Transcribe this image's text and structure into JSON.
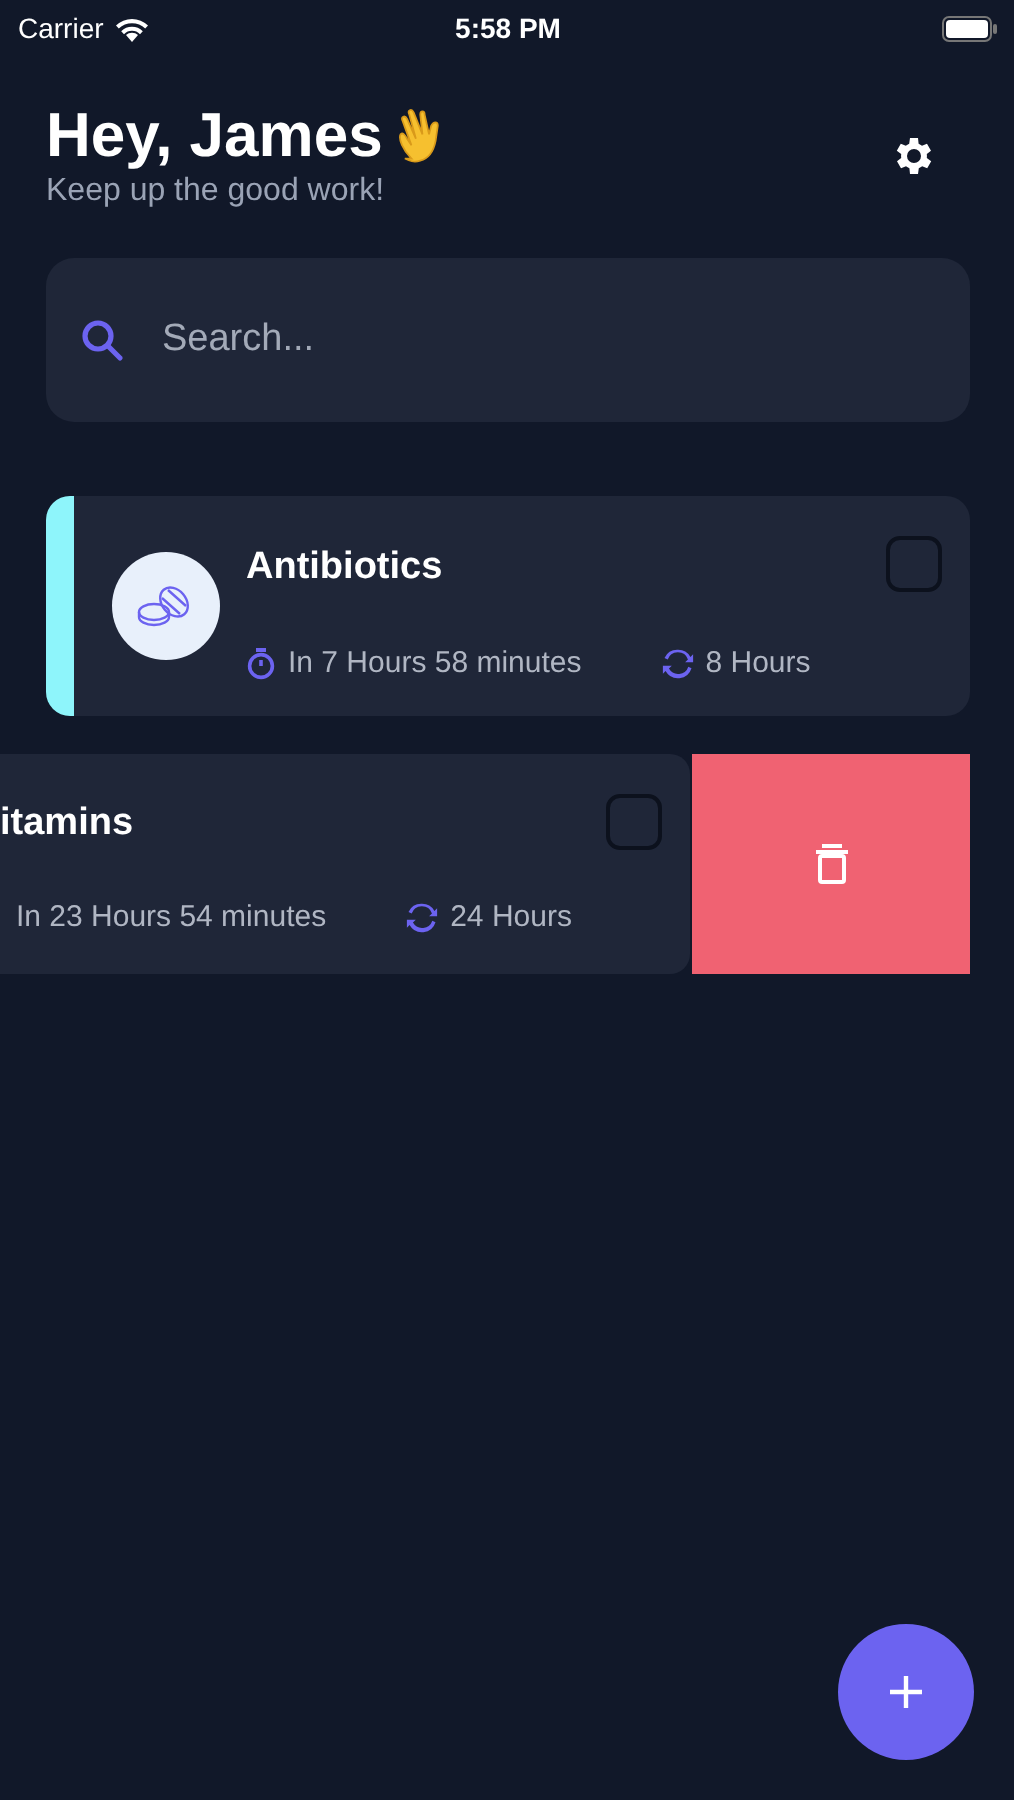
{
  "status_bar": {
    "carrier": "Carrier",
    "time": "5:58 PM"
  },
  "header": {
    "greeting": "Hey, James",
    "subtitle": "Keep up the good work!"
  },
  "search": {
    "placeholder": "Search..."
  },
  "medications": [
    {
      "name": "Antibiotics",
      "next_dose": "In 7 Hours 58 minutes",
      "interval": "8 Hours",
      "checked": false,
      "swiped": false,
      "color": "#8ef5fb"
    },
    {
      "name": "itamins",
      "next_dose": "In 23 Hours 54 minutes",
      "interval": "24 Hours",
      "checked": false,
      "swiped": true
    }
  ]
}
